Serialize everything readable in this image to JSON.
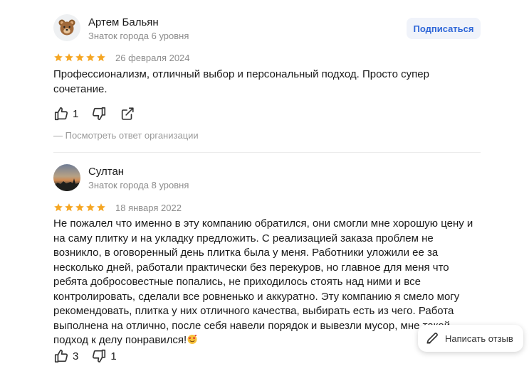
{
  "reviews": [
    {
      "author": "Артем Бальян",
      "level": "Знаток города 6 уровня",
      "rating": 5,
      "date": "26 февраля 2024",
      "text": "Профессионализм, отличный выбор и персональный подход. Просто супер сочетание.",
      "likes": "1",
      "subscribe_label": "Подписаться",
      "org_reply_label": "— Посмотреть ответ организации",
      "avatar_icon": "bear-face-icon"
    },
    {
      "author": "Султан",
      "level": "Знаток города 8 уровня",
      "rating": 5,
      "date": "18 января 2022",
      "text": "Не пожалел что именно в эту компанию обратился, они смогли мне хорошую цену и на саму плитку и на укладку предложить. С реализацией заказа проблем не возникло, в оговоренный день плитка была у меня. Работники уложили ее за несколько дней, работали практически без перекуров, но главное для меня что ребята добросовестные попались, не приходилось стоять над ними и все контролировать, сделали все ровненько и аккуратно. Эту компанию я смело могу рекомендовать, плитка у них отличного качества, выбирать есть из чего. Работа выполнена на отлично, после себя навели порядок и вывезли мусор, мне такой подход к делу понравился!",
      "likes": "3",
      "dislikes": "1",
      "avatar_icon": "sunset-photo"
    }
  ],
  "write_review_label": "Написать отзыв",
  "colors": {
    "star": "#f5a623",
    "accent": "#2f67d8",
    "muted": "#8c8c8c"
  }
}
